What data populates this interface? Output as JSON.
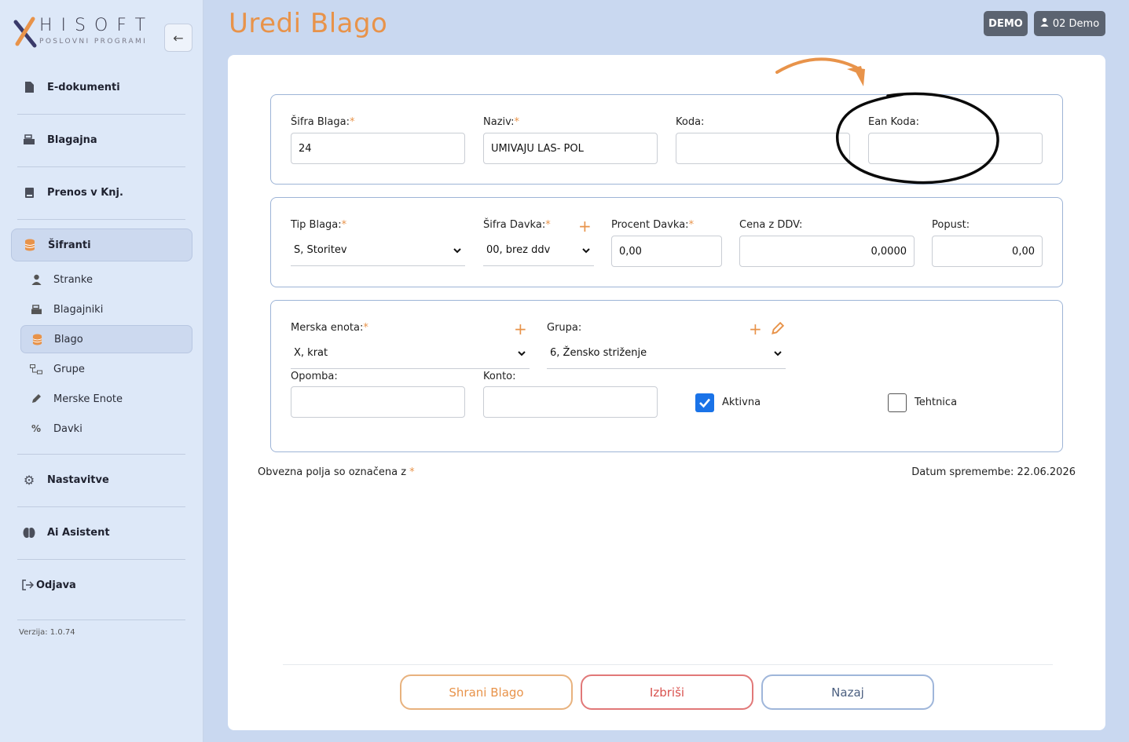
{
  "app": {
    "logo_text": "HISOFT",
    "logo_subtitle": "POSLOVNI PROGRAMI",
    "collapse_icon": "arrow-left-icon"
  },
  "sidebar": {
    "items": [
      {
        "label": "E-dokumenti",
        "icon": "file-icon"
      },
      {
        "label": "Blagajna",
        "icon": "cash-register-icon"
      },
      {
        "label": "Prenos v Knj.",
        "icon": "book-icon"
      },
      {
        "label": "Šifranti",
        "icon": "database-icon"
      },
      {
        "label": "Nastavitve",
        "icon": "gear-icon"
      },
      {
        "label": "Ai Asistent",
        "icon": "brain-icon"
      },
      {
        "label": "Odjava",
        "icon": "logout-icon"
      }
    ],
    "sub_items": [
      {
        "label": "Stranke",
        "icon": "user-icon"
      },
      {
        "label": "Blagajniki",
        "icon": "cash-register-icon"
      },
      {
        "label": "Blago",
        "icon": "database-icon"
      },
      {
        "label": "Grupe",
        "icon": "sitemap-icon"
      },
      {
        "label": "Merske Enote",
        "icon": "pencil-icon"
      },
      {
        "label": "Davki",
        "icon": "percent-icon"
      }
    ],
    "version": "Verzija: 1.0.74"
  },
  "header": {
    "title": "Uredi Blago",
    "demo_badge": "DEMO",
    "user_label": "02 Demo"
  },
  "form": {
    "sifra_blaga_label": "Šifra Blaga:",
    "sifra_blaga_value": "24",
    "naziv_label": "Naziv:",
    "naziv_value": "UMIVAJU LAS- POL",
    "koda_label": "Koda:",
    "koda_value": "",
    "ean_label": "Ean Koda:",
    "ean_value": "",
    "tip_blaga_label": "Tip Blaga:",
    "tip_blaga_value": "S, Storitev",
    "sifra_davka_label": "Šifra Davka:",
    "sifra_davka_value": "00, brez ddv",
    "procent_davka_label": "Procent Davka:",
    "procent_davka_value": "0,00",
    "cena_label": "Cena z DDV:",
    "cena_value": "0,0000",
    "popust_label": "Popust:",
    "popust_value": "0,00",
    "merska_label": "Merska enota:",
    "merska_value": "X, krat",
    "grupa_label": "Grupa:",
    "grupa_value": "6, Žensko striženje",
    "opomba_label": "Opomba:",
    "opomba_value": "",
    "konto_label": "Konto:",
    "konto_value": "",
    "aktivna_label": "Aktivna",
    "aktivna_checked": true,
    "tehtnica_label": "Tehtnica",
    "tehtnica_checked": false,
    "required_mark": "*"
  },
  "footer": {
    "required_note": "Obvezna polja so označena z",
    "datum_label": "Datum spremembe: 22.06.2026"
  },
  "buttons": {
    "save": "Shrani Blago",
    "delete": "Izbriši",
    "back": "Nazaj"
  },
  "colors": {
    "accent": "#e8934a",
    "sidebar_bg": "#dde8f8",
    "page_bg": "#c9d8f0",
    "section_border": "#9db4d6",
    "checkbox_on": "#1a73e8"
  }
}
